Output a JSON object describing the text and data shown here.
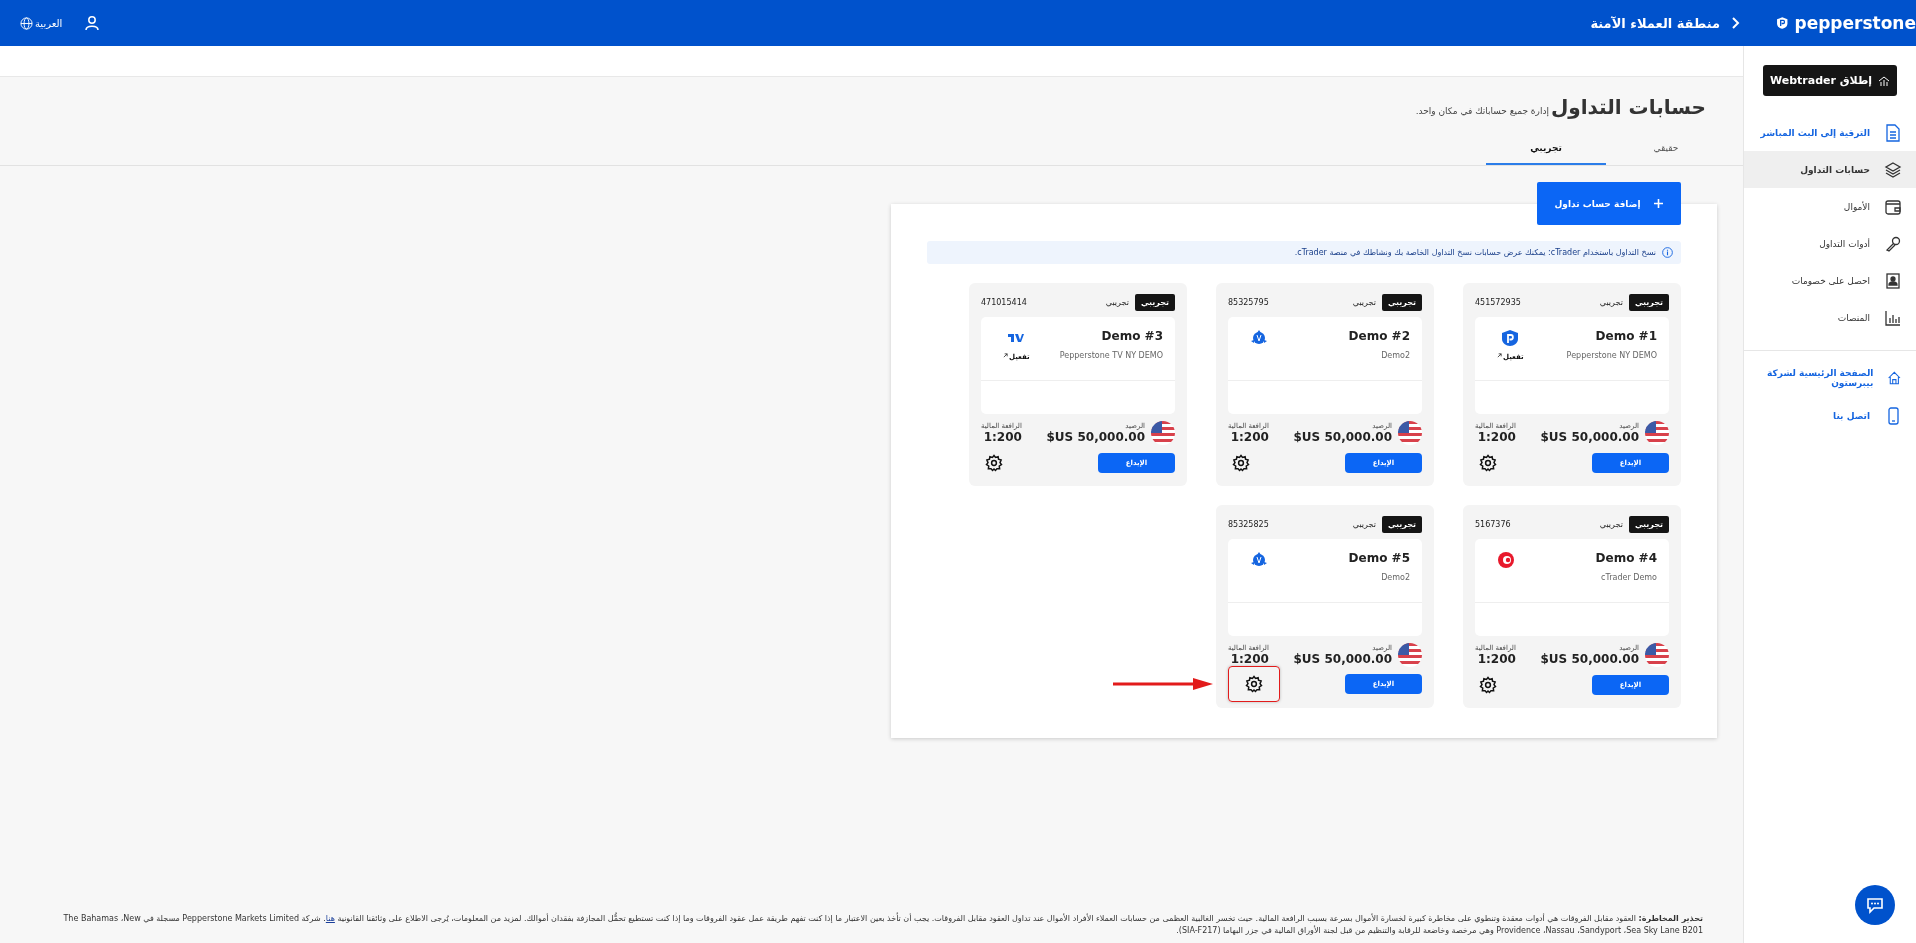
{
  "header": {
    "logo": "pepperstone",
    "title": "منطقة العملاء الآمنة",
    "language": "العربية"
  },
  "sidebar": {
    "launch_button": "إطلاق Webtrader",
    "items": [
      {
        "label": "الترقية إلى البث المباشر",
        "kind": "promo",
        "selected": false
      },
      {
        "label": "حسابات التداول",
        "kind": "nav",
        "selected": true
      },
      {
        "label": "الأموال",
        "kind": "nav",
        "selected": false
      },
      {
        "label": "أدوات التداول",
        "kind": "nav",
        "selected": false
      },
      {
        "label": "احصل على خصومات",
        "kind": "nav",
        "selected": false
      },
      {
        "label": "المنصات",
        "kind": "nav",
        "selected": false
      }
    ],
    "links": [
      {
        "label": "الصفحة الرئيسية لشركة بيبرستون"
      },
      {
        "label": "اتصل بنا"
      }
    ]
  },
  "page": {
    "title": "حسابات التداول",
    "subtitle": "إدارة جميع حساباتك في مكان واحد."
  },
  "tabs": [
    {
      "label": "حقيقي",
      "selected": false
    },
    {
      "label": "تجريبي",
      "selected": true
    }
  ],
  "add_button": "إضافة حساب تداول",
  "info": "نسخ التداول باستخدام cTrader: يمكنك عرض حسابات نسخ التداول الخاصة بك ونشاطك في منصة cTrader.",
  "accounts": [
    {
      "badge": "تجريبي",
      "type": "تجريبي",
      "number": "451572935",
      "name": "Demo #1",
      "server": "Pepperstone NY DEMO",
      "kind": "pepperstone",
      "activate": "تفعيل",
      "balance_label": "الرصيد",
      "balance": "$US 50,000.00",
      "leverage_label": "الرافعة المالية",
      "leverage": "1:200",
      "deposit": "الإيداع",
      "highlighted": false
    },
    {
      "badge": "تجريبي",
      "type": "تجريبي",
      "number": "85325795",
      "name": "Demo #2",
      "server": "Demo2",
      "kind": "metatrader",
      "balance_label": "الرصيد",
      "balance": "$US 50,000.00",
      "leverage_label": "الرافعة المالية",
      "leverage": "1:200",
      "deposit": "الإيداع",
      "highlighted": false
    },
    {
      "badge": "تجريبي",
      "type": "تجريبي",
      "number": "471015414",
      "name": "Demo #3",
      "server": "Pepperstone TV NY DEMO",
      "kind": "tradingview",
      "activate": "تفعيل",
      "balance_label": "الرصيد",
      "balance": "$US 50,000.00",
      "leverage_label": "الرافعة المالية",
      "leverage": "1:200",
      "deposit": "الإيداع",
      "highlighted": false
    },
    {
      "badge": "تجريبي",
      "type": "تجريبي",
      "number": "5167376",
      "name": "Demo #4",
      "server": "cTrader Demo",
      "kind": "ctrader",
      "balance_label": "الرصيد",
      "balance": "$US 50,000.00",
      "leverage_label": "الرافعة المالية",
      "leverage": "1:200",
      "deposit": "الإيداع",
      "highlighted": false
    },
    {
      "badge": "تجريبي",
      "type": "تجريبي",
      "number": "85325825",
      "name": "Demo #5",
      "server": "Demo2",
      "kind": "metatrader",
      "balance_label": "الرصيد",
      "balance": "$US 50,000.00",
      "leverage_label": "الرافعة المالية",
      "leverage": "1:200",
      "deposit": "الإيداع",
      "highlighted": true
    }
  ],
  "footer": {
    "before": "**تحذير المخاطرة:** العقود مقابل الفروقات هي أدوات معقدة وتنطوي على مخاطرة كبيرة لخسارة الأموال بسرعة بسبب الرافعة المالية. حيث تخسر الغالبية العظمى من حسابات العملاء الأفراد الأموال عند تداول العقود مقابل الفروقات. يجب أن تأخذ بعين الاعتبار ما إذا كنت تفهم طريقة عمل عقود الفروقات وما إذا كنت تستطيع تحمُّل المجازفة بفقدان أموالك. لمزيد من المعلومات، يُرجى الاطلاع على وثائقنا القانونية",
    "link": "هنا",
    "after": ". شركة Pepperstone Markets Limited مسجلة في The Bahamas ،New Providence ،Nassau ،Sandyport ،Sea Sky Lane B201 وهي مرخصة وخاضعة للرقابة والتنظيم من قبل لجنة الأوراق المالية في جزر البهاما (SIA-F217)."
  }
}
